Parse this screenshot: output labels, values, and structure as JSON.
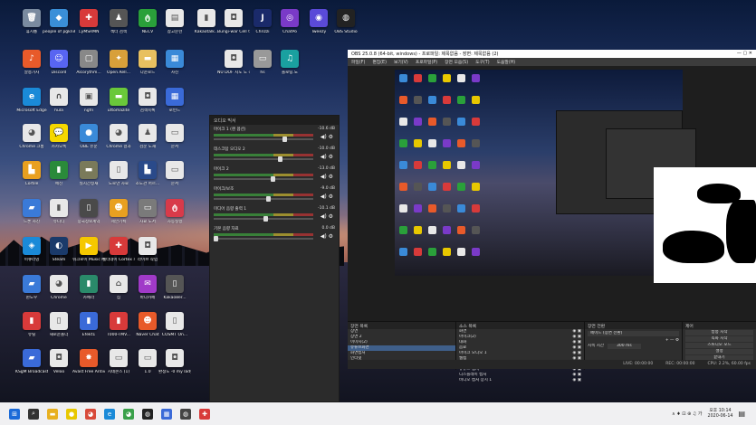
{
  "desktop": {
    "icons": [
      {
        "label": "휴지통",
        "color": "#7a8ba0",
        "glyph": "🗑",
        "col": 0,
        "row": 0
      },
      {
        "label": "people of pgknih",
        "color": "#3a8fd8",
        "glyph": "◆",
        "col": 1,
        "row": 0
      },
      {
        "label": "CyMSRMN",
        "color": "#d83a3a",
        "glyph": "✚",
        "col": 2,
        "row": 0
      },
      {
        "label": "섹터 검색",
        "color": "#555",
        "glyph": "♟",
        "col": 3,
        "row": 0
      },
      {
        "label": "NECV",
        "color": "#2aa03a",
        "glyph": "ტ",
        "col": 4,
        "row": 0
      },
      {
        "label": "참고문헌",
        "color": "#e8e8e8",
        "glyph": "▤",
        "col": 5,
        "row": 0
      },
      {
        "label": "Kakaotalk...",
        "color": "#e8e8e8",
        "glyph": "▮",
        "col": 6,
        "row": 0
      },
      {
        "label": "Bungi-war Cell 비...",
        "color": "#e8e8e8",
        "glyph": "◘",
        "col": 7,
        "row": 0
      },
      {
        "label": "Chrizzi",
        "color": "#1a2a6a",
        "glyph": "J",
        "col": 8,
        "row": 0
      },
      {
        "label": "ChatPo",
        "color": "#7a3ac8",
        "glyph": "◎",
        "col": 9,
        "row": 0
      },
      {
        "label": "Tweezy",
        "color": "#5a4ad8",
        "glyph": "◉",
        "col": 10,
        "row": 0
      },
      {
        "label": "OBS Studio",
        "color": "#222",
        "glyph": "◍",
        "col": 11,
        "row": 0
      },
      {
        "label": "알송가사",
        "color": "#e85a2a",
        "glyph": "♪",
        "col": 0,
        "row": 1
      },
      {
        "label": "Discord",
        "color": "#5865f2",
        "glyph": "☺",
        "col": 1,
        "row": 1
      },
      {
        "label": "Alcorythm...",
        "color": "#888",
        "glyph": "▢",
        "col": 2,
        "row": 1
      },
      {
        "label": "Open.Rell...",
        "color": "#d8a03a",
        "glyph": "✦",
        "col": 3,
        "row": 1
      },
      {
        "label": "다운로드",
        "color": "#e8c060",
        "glyph": "▬",
        "col": 4,
        "row": 1
      },
      {
        "label": "사진",
        "color": "#3a8ad8",
        "glyph": "▦",
        "col": 5,
        "row": 1
      },
      {
        "label": "NU DOF 지도 도 각이미",
        "color": "#e8e8e8",
        "glyph": "◘",
        "col": 7,
        "row": 1
      },
      {
        "label": "hs",
        "color": "#999",
        "glyph": "▭",
        "col": 8,
        "row": 1
      },
      {
        "label": "플로팅.노",
        "color": "#1aa0a0",
        "glyph": "♫",
        "col": 9,
        "row": 1
      },
      {
        "label": "Microsoft Edge",
        "color": "#1a8ad8",
        "glyph": "e",
        "col": 0,
        "row": 2
      },
      {
        "label": "hula",
        "color": "#e8e8e8",
        "glyph": "∩",
        "col": 1,
        "row": 2
      },
      {
        "label": "ngfn",
        "color": "#e8e8e8",
        "glyph": "▣",
        "col": 2,
        "row": 2
      },
      {
        "label": "uttomazite",
        "color": "#6ac83a",
        "glyph": "▬",
        "col": 3,
        "row": 2
      },
      {
        "label": "검색목록",
        "color": "#e8e8e8",
        "glyph": "◘",
        "col": 4,
        "row": 2
      },
      {
        "label": "로빈드",
        "color": "#3a6ad8",
        "glyph": "▦",
        "col": 5,
        "row": 2
      },
      {
        "label": "Chrome 크롬",
        "color": "#e8e8e8",
        "glyph": "◕",
        "col": 0,
        "row": 3
      },
      {
        "label": "카카오톡",
        "color": "#f5d800",
        "glyph": "💬",
        "col": 1,
        "row": 3
      },
      {
        "label": "OBE 유문",
        "color": "#3a8ad8",
        "glyph": "●",
        "col": 2,
        "row": 3
      },
      {
        "label": "Chrome 결과",
        "color": "#e8e8e8",
        "glyph": "◕",
        "col": 3,
        "row": 3
      },
      {
        "label": "검문 도재",
        "color": "#e8e8e8",
        "glyph": "♟",
        "col": 4,
        "row": 3
      },
      {
        "label": "문서",
        "color": "#e8e8e8",
        "glyph": "▭",
        "col": 5,
        "row": 3
      },
      {
        "label": "Cortile",
        "color": "#e8a020",
        "glyph": "▙",
        "col": 0,
        "row": 4
      },
      {
        "label": "메신",
        "color": "#2a8a3a",
        "glyph": "▮",
        "col": 1,
        "row": 4
      },
      {
        "label": "실시간정재",
        "color": "#7a7a5a",
        "glyph": "▬",
        "col": 2,
        "row": 4
      },
      {
        "label": "도로만 자료",
        "color": "#e8e8e8",
        "glyph": "▯",
        "col": 3,
        "row": 4
      },
      {
        "label": "조도관 어르...",
        "color": "#2a4a8a",
        "glyph": "▙",
        "col": 4,
        "row": 4
      },
      {
        "label": "문서",
        "color": "#e8e8e8",
        "glyph": "▭",
        "col": 5,
        "row": 4
      },
      {
        "label": "드론 사진",
        "color": "#3a7ad8",
        "glyph": "▰",
        "col": 0,
        "row": 5
      },
      {
        "label": "유니티",
        "color": "#e8e8e8",
        "glyph": "▮",
        "col": 1,
        "row": 5
      },
      {
        "label": "중국정보계약",
        "color": "#4a4a4a",
        "glyph": "▯",
        "col": 2,
        "row": 5
      },
      {
        "label": "제안기획",
        "color": "#e8a020",
        "glyph": "☻",
        "col": 3,
        "row": 5
      },
      {
        "label": "자료 도서",
        "color": "#7a7a7a",
        "glyph": "▭",
        "col": 4,
        "row": 5
      },
      {
        "label": "자동실행",
        "color": "#d83a4a",
        "glyph": "ტ",
        "col": 5,
        "row": 5
      },
      {
        "label": "이큐라밍",
        "color": "#1a8ad8",
        "glyph": "◈",
        "col": 0,
        "row": 6
      },
      {
        "label": "Steam",
        "color": "#1a3a6a",
        "glyph": "◐",
        "col": 1,
        "row": 6
      },
      {
        "label": "워크로이 Music Player",
        "color": "#f5c800",
        "glyph": "▶",
        "col": 2,
        "row": 6
      },
      {
        "label": "헬터데이 Cortex 도출",
        "color": "#d83a3a",
        "glyph": "✚",
        "col": 3,
        "row": 6
      },
      {
        "label": "라이브 작업",
        "color": "#e8e8e8",
        "glyph": "◘",
        "col": 4,
        "row": 6
      },
      {
        "label": "윈도우",
        "color": "#3a7ad8",
        "glyph": "▰",
        "col": 0,
        "row": 7
      },
      {
        "label": "Chrome",
        "color": "#e8e8e8",
        "glyph": "◕",
        "col": 1,
        "row": 7
      },
      {
        "label": "카메라",
        "color": "#2a8a6a",
        "glyph": "▮",
        "col": 2,
        "row": 7
      },
      {
        "label": "집",
        "color": "#e8e8e8",
        "glyph": "⌂",
        "col": 3,
        "row": 7
      },
      {
        "label": "바다카페",
        "color": "#a03ac8",
        "glyph": "✉",
        "col": 4,
        "row": 7
      },
      {
        "label": "Kakao8er...",
        "color": "#555",
        "glyph": "▯",
        "col": 5,
        "row": 7
      },
      {
        "label": "유틸",
        "color": "#d83a3a",
        "glyph": "▮",
        "col": 0,
        "row": 8
      },
      {
        "label": "새로운폴더",
        "color": "#e8e8e8",
        "glyph": "▯",
        "col": 1,
        "row": 8
      },
      {
        "label": "Efekt1",
        "color": "#3a6ad8",
        "glyph": "▮",
        "col": 2,
        "row": 8
      },
      {
        "label": "T000-TMV...",
        "color": "#d83a3a",
        "glyph": "▮",
        "col": 3,
        "row": 8
      },
      {
        "label": "Naver Chat",
        "color": "#e85a2a",
        "glyph": "☻",
        "col": 4,
        "row": 8
      },
      {
        "label": "COSMT On...",
        "color": "#e8e8e8",
        "glyph": "▯",
        "col": 5,
        "row": 8
      },
      {
        "label": "KSgM Broadcaster",
        "color": "#3a6ad8",
        "glyph": "▰",
        "col": 0,
        "row": 9
      },
      {
        "label": "Veloo",
        "color": "#e8e8e8",
        "glyph": "◘",
        "col": 1,
        "row": 9
      },
      {
        "label": "Avast Free Antivirus",
        "color": "#e85a2a",
        "glyph": "✸",
        "col": 2,
        "row": 9
      },
      {
        "label": "지네몬스 (1)",
        "color": "#e8e8e8",
        "glyph": "▭",
        "col": 3,
        "row": 9
      },
      {
        "label": "1.0",
        "color": "#e8e8e8",
        "glyph": "▭",
        "col": 4,
        "row": 9
      },
      {
        "label": "환청도 -0 my lady",
        "color": "#e8e8e8",
        "glyph": "◘",
        "col": 5,
        "row": 9
      }
    ]
  },
  "mixer": {
    "title": "오디오 믹서",
    "channels": [
      {
        "name": "마이크 1 (랜 옵션)",
        "db": "-10.6 dB",
        "level": 0.72
      },
      {
        "name": "데스크탑 오디오 2",
        "db": "-10.0 dB",
        "level": 0.68
      },
      {
        "name": "마이크 2",
        "db": "-13.0 dB",
        "level": 0.6
      },
      {
        "name": "마이크/보조",
        "db": "-9.0 dB",
        "level": 0.55
      },
      {
        "name": "미디어 음향 출력 1",
        "db": "-10.1 dB",
        "level": 0.52
      },
      {
        "name": "기본 음향 자료",
        "db": "0.0 dB",
        "level": 0.0
      }
    ]
  },
  "obs": {
    "title": "OBS 25.0.8 (64-bit, windows) - 프로파일: 제목없음 - 장면: 제목없음 (2)",
    "controls": "— ▢ ✕",
    "menu": [
      "파일(F)",
      "편집(E)",
      "보기(V)",
      "프로파일(P)",
      "장면 모음(S)",
      "도구(T)",
      "도움말(H)"
    ],
    "docks": {
      "scenes": {
        "title": "장면 목록",
        "items": [
          "장면",
          "장면 2",
          "이미지(2)",
          "유튜브화면",
          "화면캡처",
          "인터넷"
        ],
        "selected": 3,
        "toolbar": "+ — ∧ ∨"
      },
      "sources": {
        "title": "소스 목록",
        "items": [
          "화면",
          "마이크(2)",
          "대화",
          "음료",
          "마이크 오디오 1",
          "웹캠",
          "빈 화면",
          "유튜브 캡처",
          "디스플레이 캡처",
          "비디오 캡처 장치 1"
        ],
        "toolbar": "+ — ⚙ ∧ ∨"
      },
      "mixer2": {
        "title": "장면 전환",
        "fade": "페이드 (장면 전환)",
        "duration_label": "지속 시간",
        "duration": "300 ms",
        "toolbar": "+ — ⚙"
      },
      "controls": {
        "title": "제어",
        "buttons": [
          "방송 시작",
          "녹화 시작",
          "스튜디오 모드",
          "설정",
          "끝내기"
        ]
      }
    },
    "status": [
      "LIVE: 00:00:00",
      "REC: 00:00:00",
      "CPU: 2.2%, 60.00 fps"
    ]
  },
  "taskbar": {
    "icons": [
      {
        "name": "windows-start-icon",
        "glyph": "⊞",
        "color": "#1a6ad8"
      },
      {
        "name": "search-icon",
        "glyph": "⌕",
        "color": "#333"
      },
      {
        "name": "file-explorer-icon",
        "glyph": "▬",
        "color": "#e8b020"
      },
      {
        "name": "kakaotalk-icon",
        "glyph": "●",
        "color": "#e8c800"
      },
      {
        "name": "chrome-icon",
        "glyph": "◕",
        "color": "#d84a3a"
      },
      {
        "name": "edge-icon",
        "glyph": "e",
        "color": "#1a8ad8"
      },
      {
        "name": "chrome-icon-2",
        "glyph": "◕",
        "color": "#3aa04a"
      },
      {
        "name": "obs-icon",
        "glyph": "◍",
        "color": "#222"
      },
      {
        "name": "photos-icon",
        "glyph": "▦",
        "color": "#3a6ad8"
      },
      {
        "name": "obs-icon-2",
        "glyph": "◍",
        "color": "#444"
      },
      {
        "name": "game-icon",
        "glyph": "✚",
        "color": "#d83a3a"
      }
    ],
    "tray": "∧ ♦ ⊡ ⊕ ♫ 가",
    "time": "오후 10:14",
    "date": "2020-06-14"
  }
}
